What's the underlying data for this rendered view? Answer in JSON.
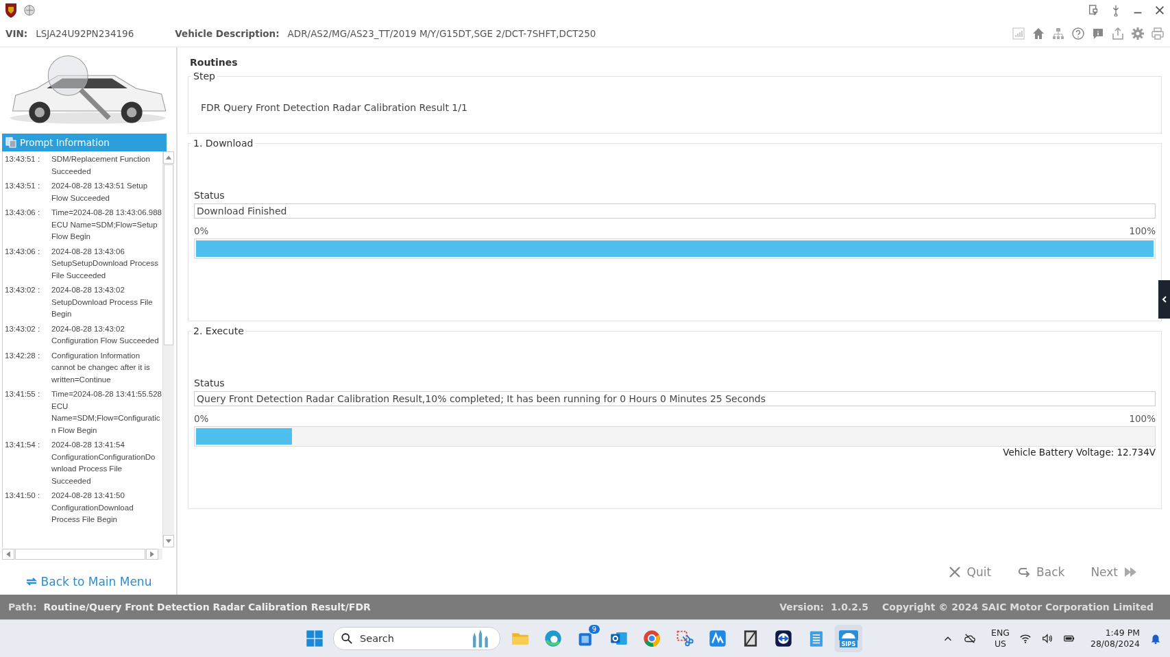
{
  "header": {
    "vin_label": "VIN:",
    "vin": "LSJA24U92PN234196",
    "description_label": "Vehicle Description:",
    "description": "ADR/AS2/MG/AS23_TT/2019 M/Y/G15DT,SGE 2/DCT-7SHFT,DCT250"
  },
  "sidebar": {
    "panel_title": "Prompt Information",
    "log": [
      {
        "time": "13:43:51 :",
        "message": "SDM/Replacement Function Succeeded"
      },
      {
        "time": "13:43:51 :",
        "message": "2024-08-28 13:43:51 Setup Flow  Succeeded"
      },
      {
        "time": "13:43:06 :",
        "message": "Time=2024-08-28 13:43:06.988 ECU Name=SDM;Flow=Setup Flow Begin"
      },
      {
        "time": "13:43:06 :",
        "message": "2024-08-28 13:43:06 SetupSetupDownload Process File Succeeded"
      },
      {
        "time": "13:43:02 :",
        "message": "2024-08-28 13:43:02 SetupDownload Process File Begin"
      },
      {
        "time": "13:43:02 :",
        "message": "2024-08-28 13:43:02 Configuration Flow  Succeeded"
      },
      {
        "time": "13:42:28 :",
        "message": "Configuration Information cannot be changec after it is written=Continue"
      },
      {
        "time": "13:41:55 :",
        "message": "Time=2024-08-28 13:41:55.528 ECU Name=SDM;Flow=Configuratic n Flow Begin"
      },
      {
        "time": "13:41:54 :",
        "message": "2024-08-28 13:41:54 ConfigurationConfigurationDo wnload Process File Succeeded"
      },
      {
        "time": "13:41:50 :",
        "message": "2024-08-28 13:41:50 ConfigurationDownload Process File Begin"
      }
    ],
    "back_link": "Back to Main Menu"
  },
  "routines": {
    "title": "Routines",
    "step": {
      "legend": "Step",
      "text": "FDR Query Front Detection Radar Calibration Result 1/1"
    },
    "sections": [
      {
        "legend": "1. Download",
        "status_label": "Status",
        "status": "Download Finished",
        "min_label": "0%",
        "max_label": "100%",
        "level": 1.0
      },
      {
        "legend": "2. Execute",
        "status_label": "Status",
        "status": "Query Front Detection Radar Calibration Result,10% completed;  It has been running for 0 Hours 0 Minutes 25 Seconds",
        "min_label": "0%",
        "max_label": "100%",
        "level": 0.1
      }
    ],
    "battery": "Vehicle Battery Voltage: 12.734V"
  },
  "buttons": [
    {
      "kind": "quit",
      "label": "Quit"
    },
    {
      "kind": "back",
      "label": "Back"
    },
    {
      "kind": "next",
      "label": "Next"
    }
  ],
  "status_bar": {
    "path_label": "Path:",
    "path": "Routine/Query Front Detection Radar Calibration Result/FDR",
    "version_label": "Version:",
    "version": "1.0.2.5",
    "copyright": "Copyright © 2024 SAIC Motor Corporation Limited"
  },
  "taskbar": {
    "search_placeholder": "Search",
    "mail_badge": "9",
    "app_label": "SIPS",
    "language": "ENG",
    "region": "US",
    "time": "1:49 PM",
    "date": "28/08/2024"
  }
}
